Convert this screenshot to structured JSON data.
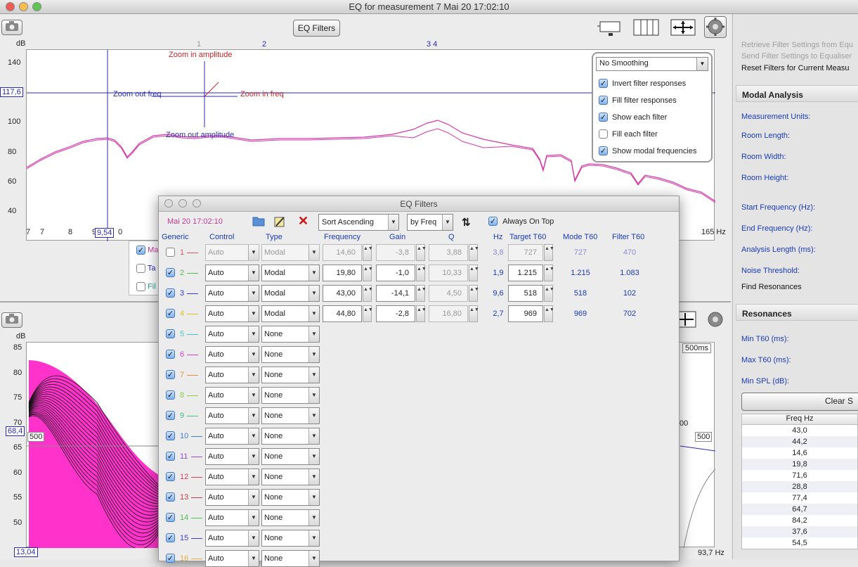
{
  "window": {
    "title": "EQ for measurement 7 Mai 20 17:02:10"
  },
  "toolbar": {
    "eq_filters_button": "EQ Filters"
  },
  "top_graph": {
    "y_unit": "dB",
    "y_ticks": [
      "140",
      "120",
      "100",
      "80",
      "60",
      "40"
    ],
    "x_ticks": [
      "7",
      "7",
      "8",
      "9",
      "9,54",
      "0"
    ],
    "x_end_label": "165 Hz",
    "cursor_value": "117,6",
    "top_markers": [
      "1",
      "2",
      "3 4"
    ],
    "zoom_labels": {
      "zoom_in_amplitude": "Zoom in amplitude",
      "zoom_out_freq": "Zoom out freq",
      "zoom_in_freq": "Zoom in freq",
      "zoom_out_amplitude": "Zoom out amplitude"
    },
    "colors": {
      "trace": "#d43aa8",
      "cursor": "#2a2ab5",
      "zoom_text": "#cc2222"
    }
  },
  "options_panel": {
    "smoothing": "No Smoothing",
    "options": [
      {
        "label": "Invert filter responses",
        "checked": true
      },
      {
        "label": "Fill filter responses",
        "checked": true
      },
      {
        "label": "Show each filter",
        "checked": true
      },
      {
        "label": "Fill each filter",
        "checked": false
      },
      {
        "label": "Show modal frequencies",
        "checked": true
      }
    ]
  },
  "legend_partial": [
    "Ma",
    "Ta",
    "Fil"
  ],
  "bottom_graph": {
    "y_unit": "dB",
    "y_ticks": [
      "85",
      "80",
      "75",
      "70",
      "65",
      "60",
      "55",
      "50"
    ],
    "cursor_value": "68,4",
    "cursor_tag": "500",
    "x_start": "13,04",
    "x_end": "93,7 Hz",
    "time_label": "500ms",
    "right_tag": "500",
    "right_tag2": "00",
    "colors": {
      "fill": "#ff33cc"
    }
  },
  "right_panel": {
    "menu": [
      "Retrieve Filter Settings from Equ",
      "Send Filter Settings to Equaliser",
      "Reset Filters for Current Measu"
    ],
    "modal_header": "Modal Analysis",
    "modal_fields": [
      "Measurement Units:",
      "Room Length:",
      "Room Width:",
      "Room Height:",
      "Start Frequency (Hz):",
      "End Frequency (Hz):",
      "Analysis Length (ms):",
      "Noise Threshold:"
    ],
    "find_resonances": "Find Resonances",
    "resonances_header": "Resonances",
    "res_fields": [
      "Min T60 (ms):",
      "Max T60 (ms):",
      "Min SPL (dB):"
    ],
    "clear_button": "Clear S",
    "table_header": "Freq Hz",
    "table_rows": [
      "43,0",
      "44,2",
      "14,6",
      "19,8",
      "71,6",
      "28,8",
      "77,4",
      "64,7",
      "84,2",
      "37,6",
      "54,5"
    ]
  },
  "dialog": {
    "title": "EQ Filters",
    "timestamp": "Mai 20 17:02:10",
    "sort": "Sort Ascending",
    "by": "by Freq",
    "always_on_top": "Always On Top",
    "headers": {
      "generic": "Generic",
      "control": "Control",
      "type": "Type",
      "frequency": "Frequency",
      "gain": "Gain",
      "q": "Q",
      "hz": "Hz",
      "target": "Target T60",
      "mode": "Mode T60",
      "filter": "Filter T60"
    },
    "rows": [
      {
        "n": "1",
        "control": "Auto",
        "type": "Modal",
        "freq": "14,60",
        "gain": "-3,8",
        "q": "3,88",
        "hz": "3,8",
        "target": "727",
        "mode": "727",
        "filter": "470",
        "checked": false,
        "disabled": true,
        "color": "#d85a6a"
      },
      {
        "n": "2",
        "control": "Auto",
        "type": "Modal",
        "freq": "19,80",
        "gain": "-1,0",
        "q": "10,33",
        "hz": "1,9",
        "target": "1.215",
        "mode": "1.215",
        "filter": "1.083",
        "checked": true,
        "disabled": false,
        "color": "#4cc24c"
      },
      {
        "n": "3",
        "control": "Auto",
        "type": "Modal",
        "freq": "43,00",
        "gain": "-14,1",
        "q": "4,50",
        "hz": "9,6",
        "target": "518",
        "mode": "518",
        "filter": "102",
        "checked": true,
        "disabled": false,
        "color": "#3a3ae0"
      },
      {
        "n": "4",
        "control": "Auto",
        "type": "Modal",
        "freq": "44,80",
        "gain": "-2,8",
        "q": "16,80",
        "hz": "2,7",
        "target": "969",
        "mode": "969",
        "filter": "702",
        "checked": true,
        "disabled": false,
        "color": "#e0c020"
      },
      {
        "n": "5",
        "control": "Auto",
        "type": "None",
        "checked": true,
        "color": "#40c8c8"
      },
      {
        "n": "6",
        "control": "Auto",
        "type": "None",
        "checked": true,
        "color": "#d040d0"
      },
      {
        "n": "7",
        "control": "Auto",
        "type": "None",
        "checked": true,
        "color": "#e09040"
      },
      {
        "n": "8",
        "control": "Auto",
        "type": "None",
        "checked": true,
        "color": "#90d040"
      },
      {
        "n": "9",
        "control": "Auto",
        "type": "None",
        "checked": true,
        "color": "#40c080"
      },
      {
        "n": "10",
        "control": "Auto",
        "type": "None",
        "checked": true,
        "color": "#4080d0"
      },
      {
        "n": "11",
        "control": "Auto",
        "type": "None",
        "checked": true,
        "color": "#9050d0"
      },
      {
        "n": "12",
        "control": "Auto",
        "type": "None",
        "checked": true,
        "color": "#d04060"
      },
      {
        "n": "13",
        "control": "Auto",
        "type": "None",
        "checked": true,
        "color": "#c04040"
      },
      {
        "n": "14",
        "control": "Auto",
        "type": "None",
        "checked": true,
        "color": "#50c050"
      },
      {
        "n": "15",
        "control": "Auto",
        "type": "None",
        "checked": true,
        "color": "#4040d0"
      },
      {
        "n": "16",
        "control": "Auto",
        "type": "None",
        "checked": true,
        "color": "#e0b040"
      }
    ]
  }
}
